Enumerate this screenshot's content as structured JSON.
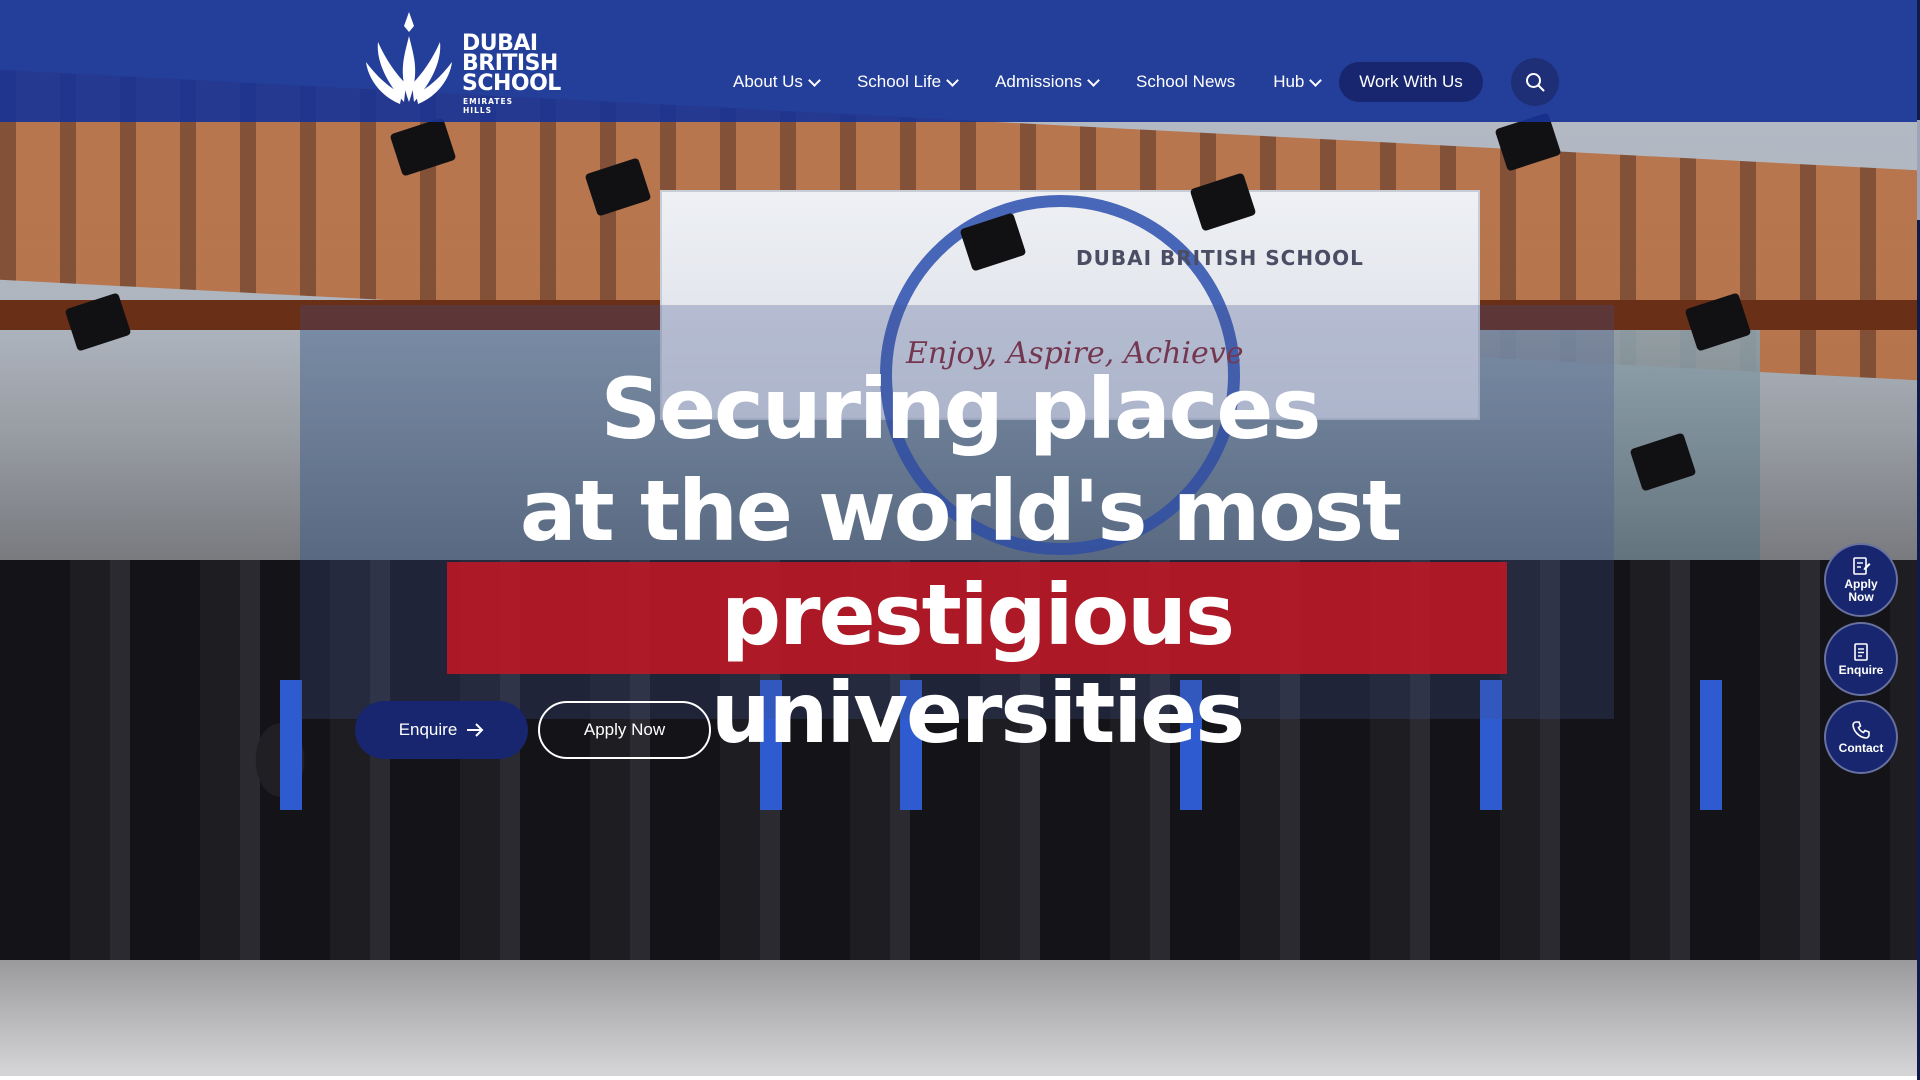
{
  "brand": {
    "logo_line1": "DUBAI",
    "logo_line2": "BRITISH",
    "logo_line3": "SCHOOL",
    "logo_sub": "EMIRATES HILLS",
    "banner_name": "DUBAI BRITISH SCHOOL",
    "banner_motto": "Enjoy, Aspire, Achieve"
  },
  "nav": {
    "items": [
      {
        "label": "About Us",
        "has_dropdown": true
      },
      {
        "label": "School Life",
        "has_dropdown": true
      },
      {
        "label": "Admissions",
        "has_dropdown": true
      },
      {
        "label": "School News",
        "has_dropdown": false
      },
      {
        "label": "Hub",
        "has_dropdown": true
      }
    ],
    "cta_label": "Work With Us",
    "search_icon": "search-icon"
  },
  "hero": {
    "headline_line1": "Securing places",
    "headline_line2": "at the world's most",
    "headline_highlight": "prestigious universities",
    "enquire_label": "Enquire",
    "apply_label": "Apply Now"
  },
  "side_actions": [
    {
      "label_line1": "Apply",
      "label_line2": "Now",
      "icon": "form-icon"
    },
    {
      "label_line1": "Enquire",
      "label_line2": "",
      "icon": "document-icon"
    },
    {
      "label_line1": "Contact",
      "label_line2": "",
      "icon": "phone-icon"
    }
  ],
  "colors": {
    "header_blue": "#1834a0",
    "navy": "#17266e",
    "highlight_red": "#c41622"
  }
}
